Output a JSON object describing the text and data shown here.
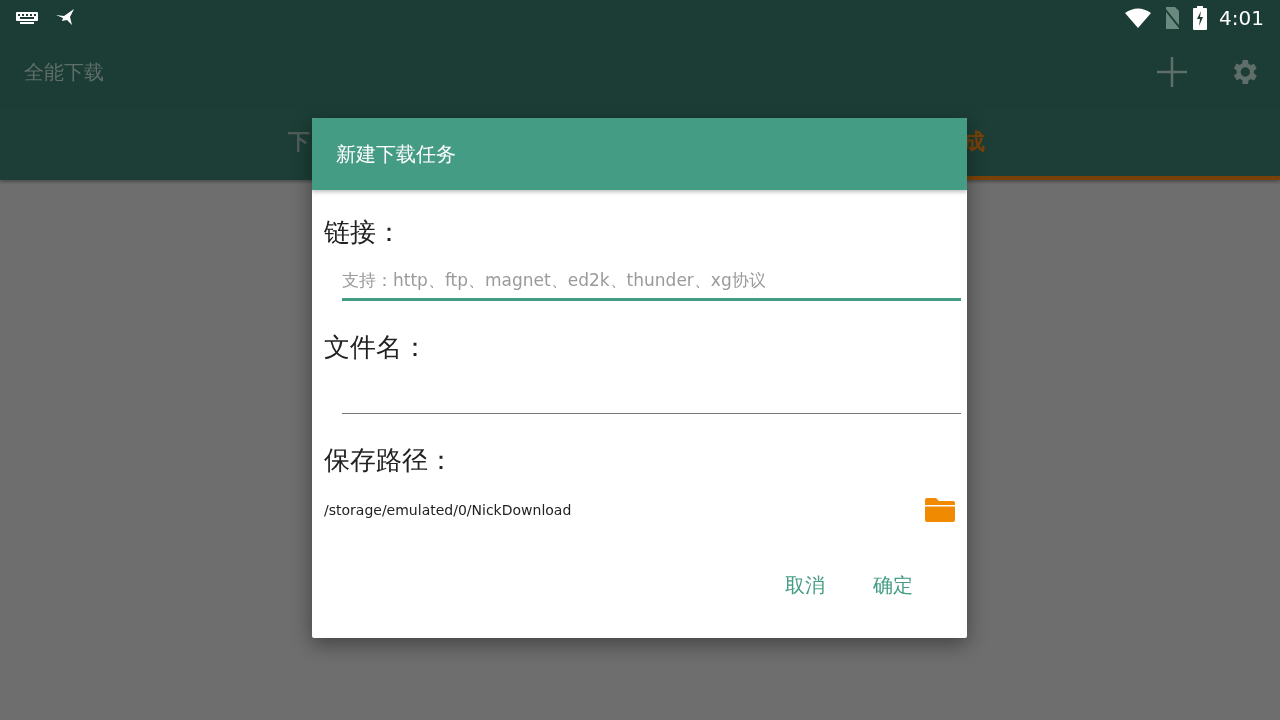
{
  "status_bar": {
    "time": "4:01"
  },
  "app_bar": {
    "title": "全能下载"
  },
  "tabs": [
    {
      "label": "下",
      "selected": false
    },
    {
      "label": "成",
      "selected": true
    }
  ],
  "dialog": {
    "title": "新建下载任务",
    "fields": [
      {
        "label": "链接：",
        "placeholder": "支持：http、ftp、magnet、ed2k、thunder、xg协议",
        "focused": true
      },
      {
        "label": "文件名：",
        "focused": false
      }
    ],
    "save_path": {
      "label": "保存路径：",
      "path": "/storage/emulated/0/NickDownload"
    },
    "buttons": [
      "取消",
      "确定"
    ]
  }
}
